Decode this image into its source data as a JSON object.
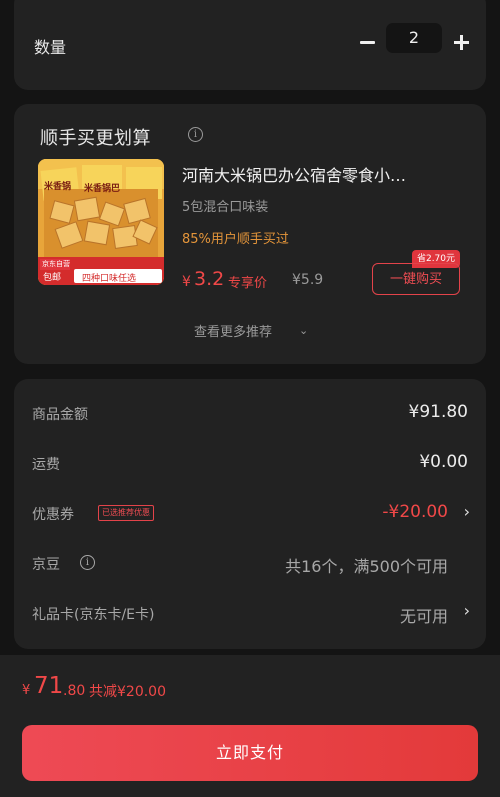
{
  "quantity": {
    "label": "数量",
    "value": "2"
  },
  "bundle": {
    "title": "顺手买更划算",
    "product": {
      "title": "河南大米锅巴办公宿舍零食小…",
      "spec": "5包混合口味装",
      "stat": "85%用户顺手买过",
      "price_symbol": "¥",
      "price": "3.2",
      "price_tag": "专享价",
      "original_price": "¥5.9",
      "save_badge": "省2.70元",
      "buy_label": "一键购买",
      "thumb_text": {
        "brand": "米香锅",
        "brand2": "米香锅巴",
        "badge1": "京东自营",
        "badge2": "包邮",
        "banner": "四种口味任选"
      }
    },
    "more_label": "查看更多推荐"
  },
  "fees": {
    "goods": {
      "label": "商品金额",
      "value": "¥91.80"
    },
    "shipping": {
      "label": "运费",
      "value": "¥0.00"
    },
    "coupon": {
      "label": "优惠券",
      "badge": "已选推荐优惠",
      "value": "-¥20.00"
    },
    "jingdou": {
      "label": "京豆",
      "value": "共16个，满500个可用"
    },
    "giftcard": {
      "label": "礼品卡(京东卡/E卡)",
      "value": "无可用"
    }
  },
  "footer": {
    "total_symbol": "¥",
    "total_int": "71",
    "total_dec": ".80",
    "discount": "共减¥20.00",
    "pay_label": "立即支付"
  },
  "colors": {
    "accent": "#f04848",
    "card": "#222222",
    "background": "#141414",
    "stat": "#e4953a"
  },
  "icons": [
    "minus-icon",
    "plus-icon",
    "info-icon",
    "chevron-down-icon",
    "chevron-right-icon"
  ]
}
